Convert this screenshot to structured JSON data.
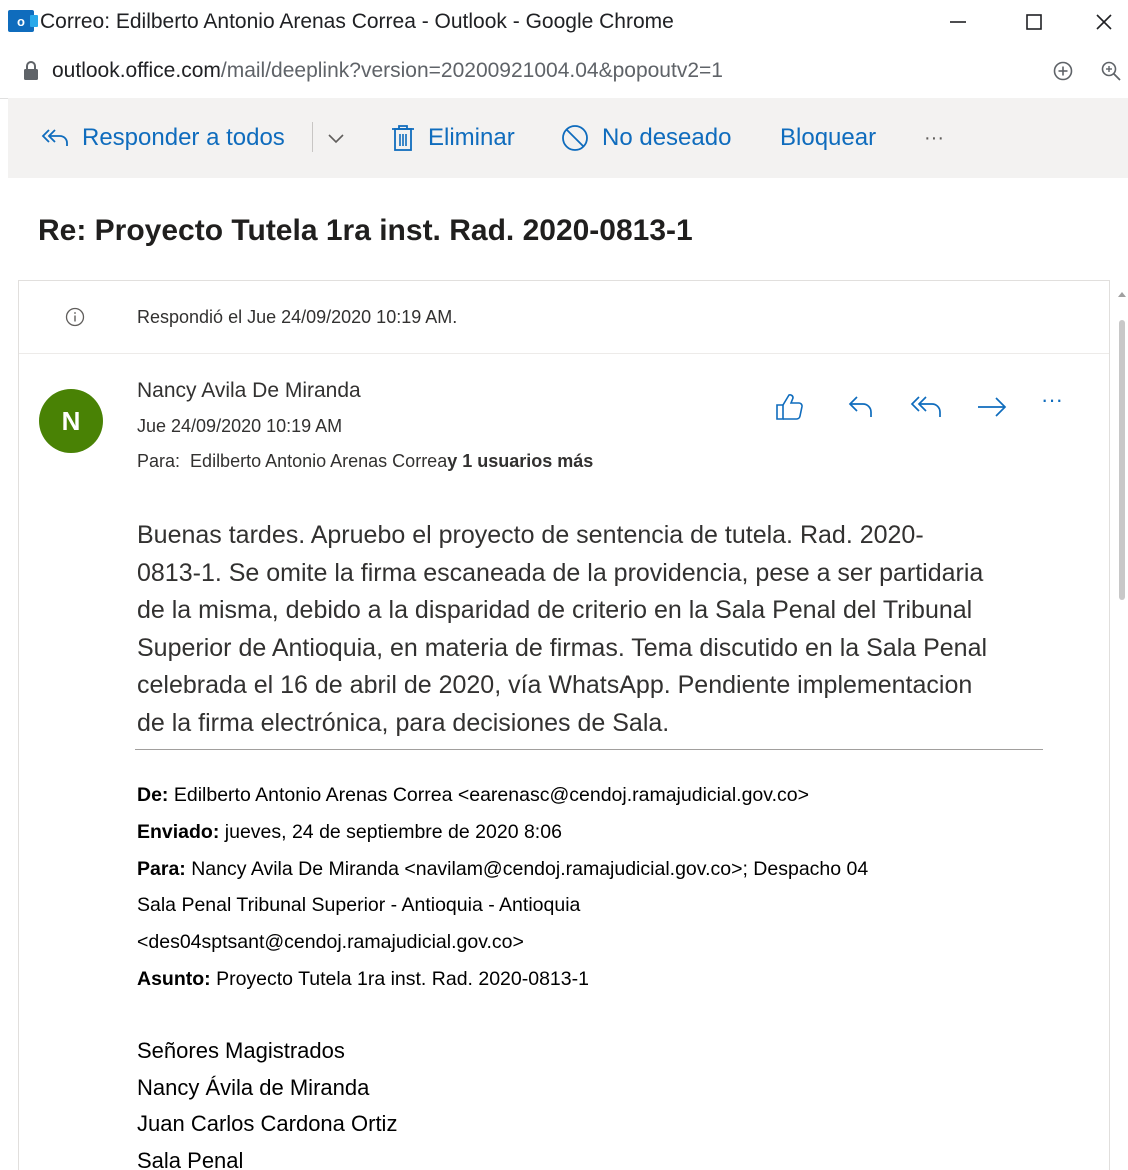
{
  "window": {
    "title": "Correo: Edilberto Antonio Arenas Correa - Outlook - Google Chrome",
    "app_icon": "outlook-icon",
    "app_icon_letter": "o"
  },
  "addressbar": {
    "url_domain": "outlook.office.com",
    "url_path": "/mail/deeplink?version=20200921004.04&popoutv2=1"
  },
  "toolbar": {
    "reply_all": "Responder a todos",
    "delete": "Eliminar",
    "junk": "No deseado",
    "block": "Bloquear",
    "more": "···"
  },
  "message": {
    "subject": "Re: Proyecto Tutela 1ra inst. Rad. 2020-0813-1",
    "info": "Respondió el Jue 24/09/2020 10:19 AM.",
    "avatar_initial": "N",
    "avatar_color": "#498205",
    "sender": "Nancy Avila De Miranda",
    "date": "Jue 24/09/2020 10:19 AM",
    "to_label": "Para:",
    "to_name": "Edilberto Antonio Arenas Correa",
    "to_more": "y 1 usuarios más",
    "actions_more": "···",
    "body_lines": [
      "Buenas tardes. Apruebo el proyecto de sentencia de tutela. Rad. 2020-",
      "0813-1. Se omite la firma escaneada de la providencia, pese a ser partidaria",
      "de la misma, debido a la disparidad de criterio en la Sala Penal del Tribunal",
      "Superior de Antioquia, en materia de firmas. Tema discutido en la Sala Penal",
      "celebrada el 16 de abril de 2020, vía WhatsApp.  Pendiente implementacion",
      "de la firma electrónica, para decisiones de Sala."
    ]
  },
  "quoted": {
    "from_label": "De:",
    "from_value": " Edilberto Antonio Arenas Correa <earenasc@cendoj.ramajudicial.gov.co>",
    "sent_label": "Enviado:",
    "sent_value": " jueves, 24 de septiembre de 2020 8:06",
    "to_label": "Para:",
    "to_value_1": " Nancy Avila De Miranda <navilam@cendoj.ramajudicial.gov.co>; Despacho 04",
    "to_value_2": "Sala Penal Tribunal Superior - Antioquia - Antioquia",
    "to_value_3": "<des04sptsant@cendoj.ramajudicial.gov.co>",
    "subject_label": "Asunto:",
    "subject_value": " Proyecto Tutela 1ra inst. Rad. 2020-0813-1",
    "greeting_lines": [
      "Señores Magistrados",
      "Nancy Ávila de Miranda",
      "Juan Carlos Cardona Ortiz",
      "Sala Penal"
    ]
  },
  "colors": {
    "accent": "#0f6cbd",
    "commandbar_bg": "#f3f2f1"
  }
}
